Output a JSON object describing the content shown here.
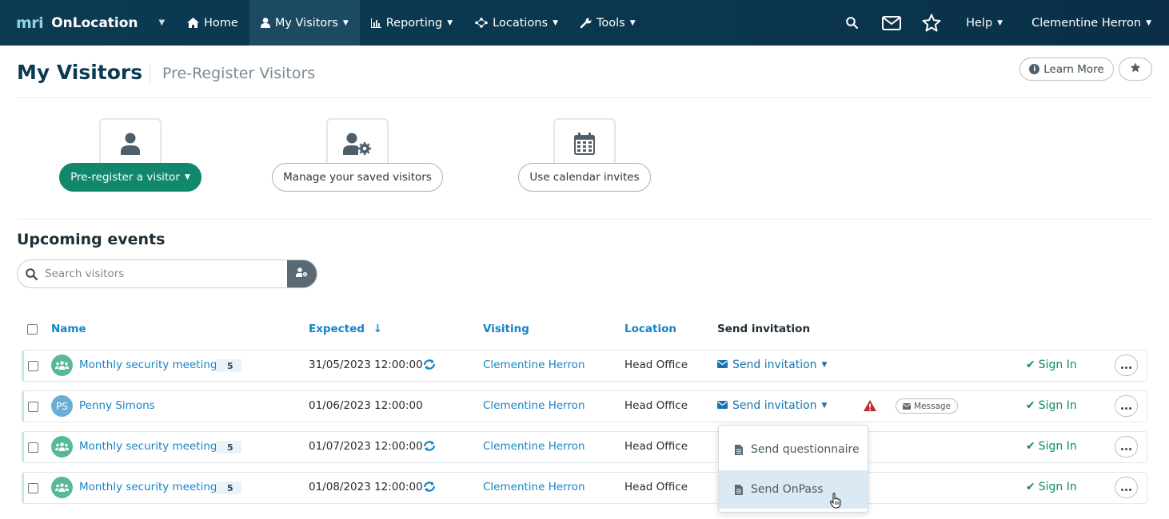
{
  "nav": {
    "logo_text": "mri",
    "brand": "OnLocation",
    "items": [
      {
        "label": "Home",
        "icon": "home-icon"
      },
      {
        "label": "My Visitors",
        "icon": "user-icon"
      },
      {
        "label": "Reporting",
        "icon": "bar-chart-icon"
      },
      {
        "label": "Locations",
        "icon": "network-icon"
      },
      {
        "label": "Tools",
        "icon": "wrench-icon"
      }
    ],
    "help": "Help",
    "user": "Clementine Herron"
  },
  "header": {
    "title": "My Visitors",
    "subtitle": "Pre-Register Visitors",
    "learn_more": "Learn More"
  },
  "actions": {
    "preregister": "Pre-register a visitor",
    "manage_saved": "Manage your saved visitors",
    "calendar": "Use calendar invites"
  },
  "upcoming": {
    "title": "Upcoming events",
    "search_placeholder": "Search visitors"
  },
  "table": {
    "headers": {
      "name": "Name",
      "expected": "Expected",
      "visiting": "Visiting",
      "location": "Location",
      "send_invitation": "Send invitation"
    },
    "rows": [
      {
        "name": "Monthly security meeting",
        "count": "5",
        "avatar": "",
        "expected": "31/05/2023 12:00:00",
        "visiting": "Clementine Herron",
        "location": "Head Office",
        "send": "Send invitation",
        "signin": "Sign In"
      },
      {
        "name": "Penny Simons",
        "count": "",
        "avatar": "PS",
        "expected": "01/06/2023 12:00:00",
        "visiting": "Clementine Herron",
        "location": "Head Office",
        "send": "Send invitation",
        "signin": "Sign In",
        "message": "Message"
      },
      {
        "name": "Monthly security meeting",
        "count": "5",
        "avatar": "",
        "expected": "01/07/2023 12:00:00",
        "visiting": "Clementine Herron",
        "location": "Head Office",
        "send": "",
        "signin": "Sign In"
      },
      {
        "name": "Monthly security meeting",
        "count": "5",
        "avatar": "",
        "expected": "01/08/2023 12:00:00",
        "visiting": "Clementine Herron",
        "location": "Head Office",
        "send": "",
        "signin": "Sign In"
      }
    ]
  },
  "dropdown": {
    "items": [
      "Send questionnaire",
      "Send OnPass"
    ]
  },
  "colors": {
    "nav_bg": "#0c3a52",
    "primary_green": "#11886b",
    "link_blue": "#1584c4",
    "warning_red": "#c0282d"
  }
}
